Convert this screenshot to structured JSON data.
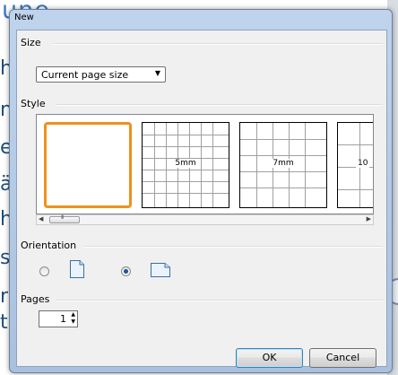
{
  "background": {
    "title_fragment": "une",
    "text_fragments": [
      "he",
      "n",
      "el",
      "äu",
      "he",
      "st",
      "rl",
      "ti"
    ]
  },
  "dialog": {
    "title": "New",
    "size": {
      "label": "Size",
      "selected": "Current page size"
    },
    "style": {
      "label": "Style",
      "templates": [
        {
          "label": ""
        },
        {
          "label": "5mm"
        },
        {
          "label": "7mm"
        },
        {
          "label": "10"
        }
      ]
    },
    "orientation": {
      "label": "Orientation",
      "selected": "landscape"
    },
    "pages": {
      "label": "Pages",
      "value": "1"
    },
    "buttons": {
      "ok": "OK",
      "cancel": "Cancel"
    }
  }
}
